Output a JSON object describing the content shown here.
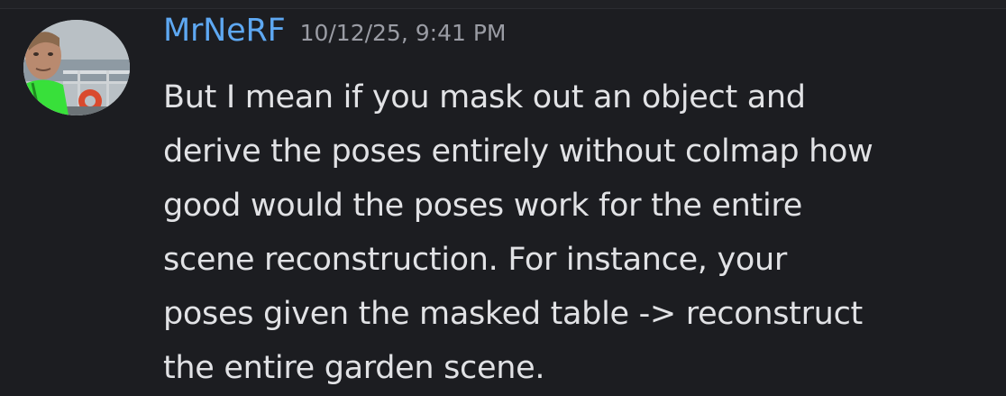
{
  "message": {
    "author": "MrNeRF",
    "timestamp": "10/12/25, 9:41 PM",
    "lines": [
      "But I mean if you mask out an object and",
      "derive the poses entirely without colmap how",
      "good would the poses work for the entire",
      "scene reconstruction. For instance, your",
      "poses given the masked table -> reconstruct",
      "the entire garden scene."
    ]
  },
  "colors": {
    "background": "#1c1d21",
    "author": "#5ea8f2",
    "timestamp": "#9a9ca4",
    "text": "#e1e2e5"
  }
}
